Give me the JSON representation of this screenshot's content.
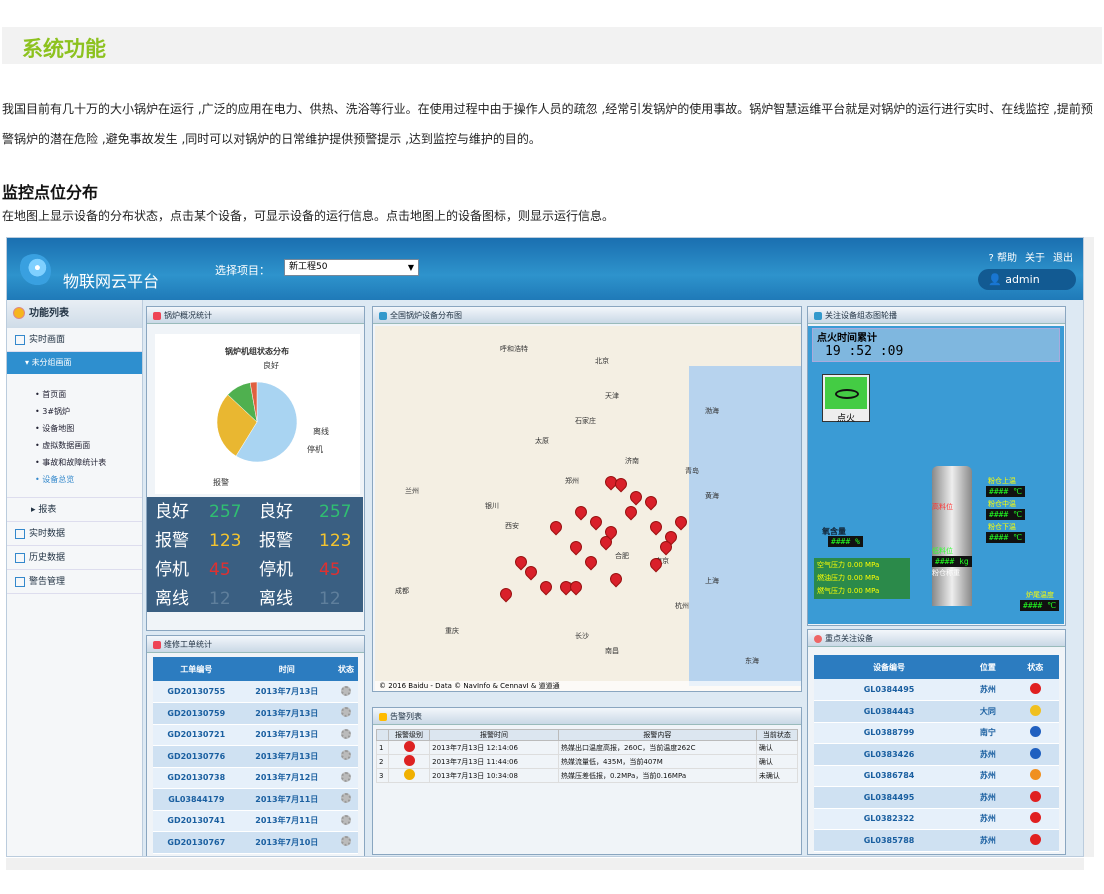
{
  "section": {
    "title": "系统功能",
    "intro": "我国目前有几十万的大小锅炉在运行 ,广泛的应用在电力、供热、洗浴等行业。在使用过程中由于操作人员的疏忽 ,经常引发锅炉的使用事故。锅炉智慧运维平台就是对锅炉的运行进行实时、在线监控 ,提前预警锅炉的潜在危险 ,避免事故发生 ,同时可以对锅炉的日常维护提供预警提示 ,达到监控与维护的目的。"
  },
  "monitor": {
    "title": "监控点位分布",
    "desc": "在地图上显示设备的分布状态，点击某个设备，可显示设备的运行信息。点击地图上的设备图标，则显示运行信息。"
  },
  "app": {
    "title": "物联网云平台",
    "select_label": "选择项目：",
    "project": "新工程50",
    "help": "帮助",
    "about": "关于",
    "logout": "退出",
    "user": "admin"
  },
  "sidebar": {
    "header": "功能列表",
    "items": [
      "实时画面",
      "未分组画面",
      "首页面",
      "3#锅炉",
      "设备地图",
      "虚拟数据画面",
      "事故和故障统计表",
      "设备总览",
      "报表",
      "实时数据",
      "历史数据",
      "警告管理"
    ]
  },
  "boiler": {
    "title": "锅炉概况统计",
    "chart_title": "锅炉机组状态分布",
    "labels": {
      "good": "良好",
      "offline": "离线",
      "stop": "停机",
      "alarm": "报警"
    },
    "stats": [
      {
        "l": "良好",
        "v": "257",
        "c": "#2fbf71"
      },
      {
        "l": "报警",
        "v": "123",
        "c": "#f4c430"
      },
      {
        "l": "停机",
        "v": "45",
        "c": "#e03030"
      },
      {
        "l": "离线",
        "v": "12",
        "c": "#5f7f9c"
      }
    ]
  },
  "chart_data": {
    "type": "pie",
    "categories": [
      "良好",
      "报警",
      "停机",
      "离线"
    ],
    "values": [
      257,
      123,
      45,
      12
    ],
    "title": "锅炉机组状态分布",
    "colors": [
      "#a9d4f2",
      "#e9b731",
      "#4fb04f",
      "#e06040"
    ]
  },
  "workorders": {
    "title": "维修工单统计",
    "headers": [
      "工单编号",
      "时间",
      "状态"
    ],
    "rows": [
      [
        "GD20130755",
        "2013年7月13日"
      ],
      [
        "GD20130759",
        "2013年7月13日"
      ],
      [
        "GD20130721",
        "2013年7月13日"
      ],
      [
        "GD20130776",
        "2013年7月13日"
      ],
      [
        "GD20130738",
        "2013年7月12日"
      ],
      [
        "GL03844179",
        "2013年7月11日"
      ],
      [
        "GD20130741",
        "2013年7月11日"
      ],
      [
        "GD20130767",
        "2013年7月10日"
      ]
    ]
  },
  "map": {
    "title": "全国锅炉设备分布图",
    "footer": "© 2016 Baidu - Data © NavInfo & CennavI & 道道通",
    "cities": [
      "呼和浩特",
      "北京",
      "天津",
      "石家庄",
      "太原",
      "济南",
      "郑州",
      "西安",
      "武汉",
      "南京",
      "上海",
      "合肥",
      "杭州",
      "长沙",
      "南昌",
      "成都",
      "重庆",
      "青岛",
      "银川",
      "兰州",
      "渤海",
      "黄海",
      "东海"
    ]
  },
  "alarms": {
    "title": "告警列表",
    "headers": [
      "报警级别",
      "报警时间",
      "报警内容",
      "当前状态"
    ],
    "rows": [
      [
        "1",
        "2013年7月13日 12:14:06",
        "热媒出口温度高报，260C，当前温度262C",
        "确认"
      ],
      [
        "2",
        "2013年7月13日 11:44:06",
        "热媒流量低，435M，当前407M",
        "确认"
      ],
      [
        "3",
        "2013年7月13日 10:34:08",
        "热媒压差低报，0.2MPa，当前0.16MPa",
        "未确认"
      ]
    ]
  },
  "diagram": {
    "title": "关注设备组态图轮播",
    "time_label": "点火时间累计",
    "time": "19 :52 :09",
    "ignite": "点火",
    "oxy": "氧含量",
    "top": "粉仓上温",
    "mid": "粉仓中温",
    "low": "粉仓下温",
    "high": "高料位",
    "lowl": "低料位",
    "weight": "粉仓称重",
    "air": "空气压力 0.00 MPa",
    "fuel": "燃油压力 0.00 MPa",
    "coal": "燃气压力 0.00 MPa",
    "furnace": "炉尾温度",
    "val_c": "#### ℃",
    "val_p": "#### %",
    "val_kg": "#### kg"
  },
  "focus": {
    "title": "重点关注设备",
    "headers": [
      "设备编号",
      "位置",
      "状态"
    ],
    "rows": [
      [
        "GL0384495",
        "苏州",
        "#e02020"
      ],
      [
        "GL0384443",
        "大同",
        "#f0c020"
      ],
      [
        "GL0388799",
        "南宁",
        "#2060c0"
      ],
      [
        "GL0383426",
        "苏州",
        "#2060c0"
      ],
      [
        "GL0386784",
        "苏州",
        "#f09020"
      ],
      [
        "GL0384495",
        "苏州",
        "#e02020"
      ],
      [
        "GL0382322",
        "苏州",
        "#e02020"
      ],
      [
        "GL0385788",
        "苏州",
        "#e02020"
      ]
    ]
  }
}
